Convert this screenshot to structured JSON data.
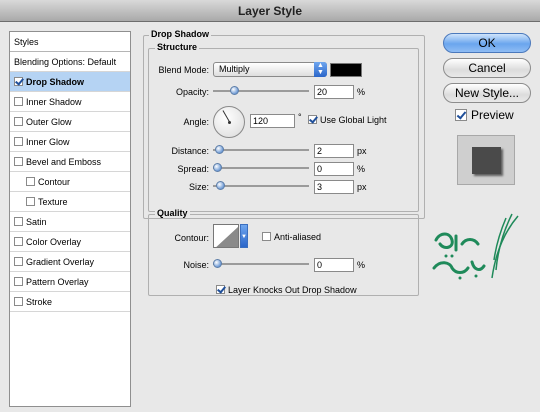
{
  "window": {
    "title": "Layer Style"
  },
  "sidebar": {
    "header": "Styles",
    "items": [
      {
        "label": "Blending Options: Default",
        "checkbox": false,
        "checked": false,
        "indent": false,
        "selected": false
      },
      {
        "label": "Drop Shadow",
        "checkbox": true,
        "checked": true,
        "indent": false,
        "selected": true
      },
      {
        "label": "Inner Shadow",
        "checkbox": true,
        "checked": false,
        "indent": false,
        "selected": false
      },
      {
        "label": "Outer Glow",
        "checkbox": true,
        "checked": false,
        "indent": false,
        "selected": false
      },
      {
        "label": "Inner Glow",
        "checkbox": true,
        "checked": false,
        "indent": false,
        "selected": false
      },
      {
        "label": "Bevel and Emboss",
        "checkbox": true,
        "checked": false,
        "indent": false,
        "selected": false
      },
      {
        "label": "Contour",
        "checkbox": true,
        "checked": false,
        "indent": true,
        "selected": false
      },
      {
        "label": "Texture",
        "checkbox": true,
        "checked": false,
        "indent": true,
        "selected": false
      },
      {
        "label": "Satin",
        "checkbox": true,
        "checked": false,
        "indent": false,
        "selected": false
      },
      {
        "label": "Color Overlay",
        "checkbox": true,
        "checked": false,
        "indent": false,
        "selected": false
      },
      {
        "label": "Gradient Overlay",
        "checkbox": true,
        "checked": false,
        "indent": false,
        "selected": false
      },
      {
        "label": "Pattern Overlay",
        "checkbox": true,
        "checked": false,
        "indent": false,
        "selected": false
      },
      {
        "label": "Stroke",
        "checkbox": true,
        "checked": false,
        "indent": false,
        "selected": false
      }
    ]
  },
  "panel": {
    "title": "Drop Shadow",
    "structure": {
      "title": "Structure",
      "blend_mode_label": "Blend Mode:",
      "blend_mode_value": "Multiply",
      "shadow_color": "#000000",
      "opacity_label": "Opacity:",
      "opacity_value": "20",
      "opacity_level": 0.2,
      "opacity_unit": "%",
      "angle_label": "Angle:",
      "angle_value": "120",
      "angle_unit": "°",
      "global_light_label": "Use Global Light",
      "global_light_checked": true,
      "distance_label": "Distance:",
      "distance_value": "2",
      "distance_level": 0.02,
      "distance_unit": "px",
      "spread_label": "Spread:",
      "spread_value": "0",
      "spread_level": 0,
      "spread_unit": "%",
      "size_label": "Size:",
      "size_value": "3",
      "size_level": 0.03,
      "size_unit": "px"
    },
    "quality": {
      "title": "Quality",
      "contour_label": "Contour:",
      "anti_aliased_label": "Anti-aliased",
      "anti_aliased_checked": false,
      "noise_label": "Noise:",
      "noise_value": "0",
      "noise_level": 0,
      "noise_unit": "%"
    },
    "knockout_label": "Layer Knocks Out Drop Shadow",
    "knockout_checked": true
  },
  "buttons": {
    "ok": "OK",
    "cancel": "Cancel",
    "new_style": "New Style...",
    "preview_label": "Preview",
    "preview_checked": true
  },
  "logo": {
    "text": "ویس تدریس",
    "color": "#1f8a5a"
  },
  "colors": {
    "accent": "#6aa5ee",
    "selection": "#b5d3f3"
  }
}
